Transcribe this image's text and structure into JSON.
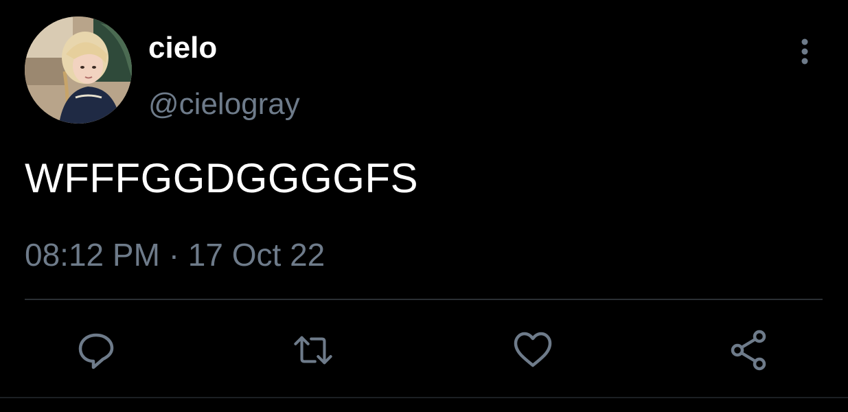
{
  "tweet": {
    "author": {
      "display_name": "cielo",
      "handle": "@cielogray",
      "avatar_icon": "avatar-photo"
    },
    "text": "WFFFGGDGGGGFS",
    "time": "08:12 PM",
    "separator": "·",
    "date": "17 Oct 22"
  },
  "actions": {
    "reply_icon": "reply-bubble-icon",
    "retweet_icon": "retweet-icon",
    "like_icon": "heart-icon",
    "share_icon": "share-icon",
    "more_icon": "more-vertical-icon"
  },
  "colors": {
    "background": "#000000",
    "primary_text": "#ffffff",
    "secondary_text": "#6e7b8a",
    "divider": "#2a2f34"
  }
}
